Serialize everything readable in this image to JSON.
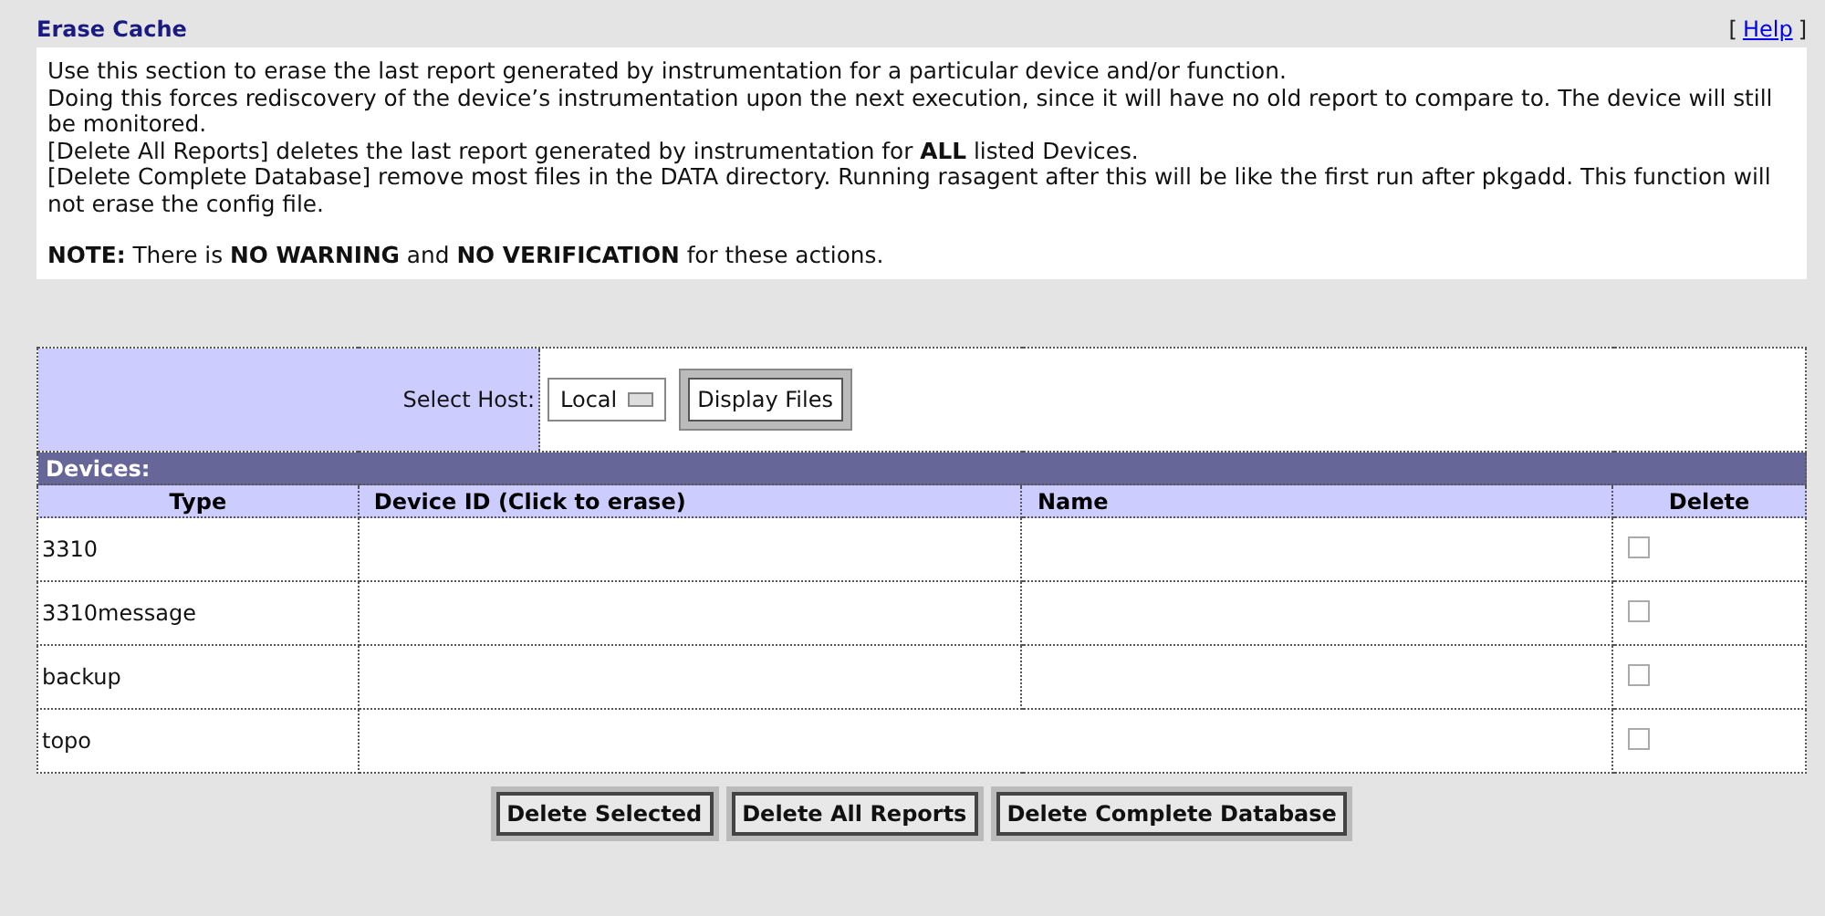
{
  "section": {
    "title": "Erase Cache",
    "help_link": "Help",
    "help_open": "[",
    "help_close": "]"
  },
  "description": [
    "Use this section to erase the last report generated by instrumentation for a particular device and/or function.",
    "Doing this forces rediscovery of the device’s instrumentation upon the next execution, since it will have no old report to compare to. The device will still be monitored.",
    "[Delete All Reports] deletes the last report generated by instrumentation for **ALL** listed Devices.",
    "[Delete Complete Database] remove most files in the DATA directory. Running rasagent after this will be like the first run after pkgadd. This function will not erase the config file."
  ],
  "note": "**NOTE:** There is **NO WARNING** and **NO VERIFICATION** for these actions.",
  "host": {
    "label": "Select Host:",
    "value": "Local",
    "button": "Display Files"
  },
  "devices": {
    "title": "Devices:",
    "columns": [
      "Type",
      "Device ID (Click to erase)",
      "Name",
      "Delete"
    ],
    "rows": [
      {
        "type": "3310",
        "checked": false
      },
      {
        "type": "3310message",
        "checked": false
      },
      {
        "type": "backup",
        "checked": false
      },
      {
        "type": "topo",
        "checked": false,
        "merged": true
      }
    ]
  },
  "buttons": [
    "Delete Selected",
    "Delete All Reports",
    "Delete Complete Database"
  ]
}
